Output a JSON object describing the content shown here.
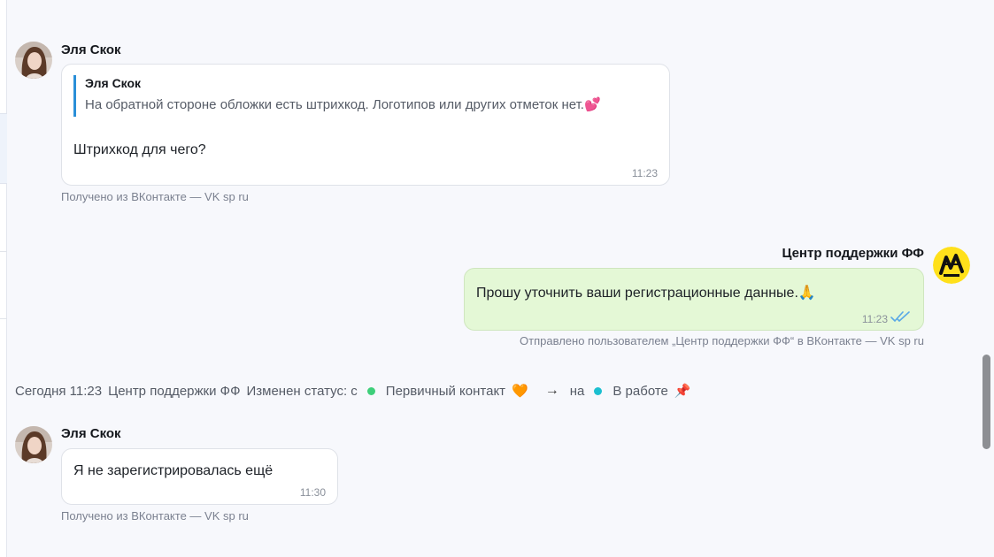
{
  "messages": [
    {
      "author": "Эля Скок",
      "quote": {
        "author": "Эля Скок",
        "text": "На обратной стороне обложки есть штрихкод. Логотипов или других отметок нет.",
        "emoji": "💕"
      },
      "text": "Штрихкод для чего?",
      "time": "11:23",
      "meta": "Получено из ВКонтакте — VK sp ru"
    },
    {
      "author": "Центр поддержки ФФ",
      "text": "Прошу уточнить ваши регистрационные данные.",
      "emoji": "🙏",
      "time": "11:23",
      "meta": "Отправлено пользователем „Центр поддержки ФФ“ в ВКонтакте — VK sp ru"
    },
    {
      "author": "Эля Скок",
      "text": "Я не зарегистрировалась ещё",
      "time": "11:30",
      "meta": "Получено из ВКонтакте — VK sp ru"
    }
  ],
  "status_change": {
    "date": "Сегодня 11:23",
    "actor": "Центр поддержки ФФ",
    "label": "Изменен статус: с",
    "from": "Первичный контакт",
    "from_emoji": "🧡",
    "arrow": "→",
    "to_word": "на",
    "to": "В работе",
    "to_emoji": "📌",
    "from_color": "#3ecf7a",
    "to_color": "#1bbfd0"
  },
  "colors": {
    "outgoing_bubble": "#e4f8d6",
    "quote_bar": "#2a8fd8",
    "read_check": "#5aa9e6"
  }
}
